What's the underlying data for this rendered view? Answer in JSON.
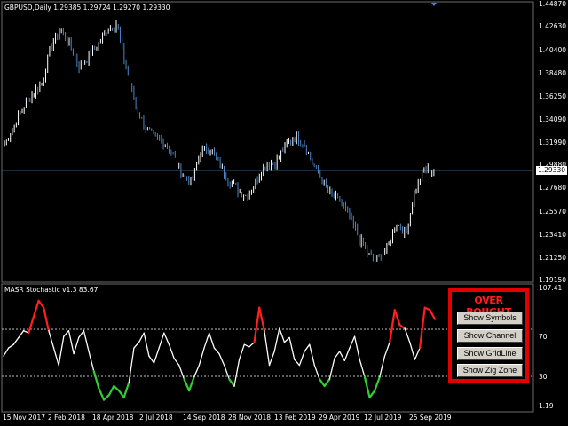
{
  "header": {
    "symbol_info": "GBPUSD,Daily  1.29385 1.29724 1.29270 1.29330",
    "indicator_info": "MASR Stochastic v1.3 83.67"
  },
  "price_axis": {
    "labels": [
      "1.44870",
      "1.42630",
      "1.40400",
      "1.38480",
      "1.36250",
      "1.34090",
      "1.31990",
      "1.29880",
      "1.27680",
      "1.25570",
      "1.23410",
      "1.21250",
      "1.19150"
    ],
    "current": "1.29330"
  },
  "indicator_axis": {
    "labels": [
      "107.41",
      "70",
      "30",
      "1.19"
    ]
  },
  "time_axis": {
    "labels": [
      "15 Nov 2017",
      "2 Feb 2018",
      "18 Apr 2018",
      "2 Jul 2018",
      "14 Sep 2018",
      "28 Nov 2018",
      "13 Feb 2019",
      "29 Apr 2019",
      "12 Jul 2019",
      "25 Sep 2019"
    ]
  },
  "panel": {
    "title": "OVER BOUGHT",
    "buttons": [
      "Show Symbols",
      "Show Channel",
      "Show GridLine",
      "Show Zig Zone"
    ]
  },
  "colors": {
    "background": "#000000",
    "candles_bull": "#ffffff",
    "candles_bear": "#4f86c6",
    "overbought": "#ff2020",
    "oversold": "#30d030",
    "border": "#e00000"
  },
  "chart_data": {
    "type": "line",
    "title": "GBPUSD,Daily",
    "price_series": [
      {
        "t": "15 Nov 2017",
        "v": 1.318
      },
      {
        "t": "",
        "v": 1.335
      },
      {
        "t": "",
        "v": 1.352
      },
      {
        "t": "",
        "v": 1.365
      },
      {
        "t": "",
        "v": 1.375
      },
      {
        "t": "",
        "v": 1.41
      },
      {
        "t": "",
        "v": 1.425
      },
      {
        "t": "2 Feb 2018",
        "v": 1.41
      },
      {
        "t": "",
        "v": 1.39
      },
      {
        "t": "",
        "v": 1.4
      },
      {
        "t": "",
        "v": 1.41
      },
      {
        "t": "",
        "v": 1.425
      },
      {
        "t": "18 Apr 2018",
        "v": 1.43
      },
      {
        "t": "",
        "v": 1.39
      },
      {
        "t": "",
        "v": 1.355
      },
      {
        "t": "",
        "v": 1.335
      },
      {
        "t": "",
        "v": 1.325
      },
      {
        "t": "2 Jul 2018",
        "v": 1.32
      },
      {
        "t": "",
        "v": 1.31
      },
      {
        "t": "",
        "v": 1.29
      },
      {
        "t": "",
        "v": 1.283
      },
      {
        "t": "14 Sep 2018",
        "v": 1.31
      },
      {
        "t": "",
        "v": 1.315
      },
      {
        "t": "",
        "v": 1.3
      },
      {
        "t": "",
        "v": 1.285
      },
      {
        "t": "28 Nov 2018",
        "v": 1.275
      },
      {
        "t": "",
        "v": 1.27
      },
      {
        "t": "",
        "v": 1.285
      },
      {
        "t": "",
        "v": 1.3
      },
      {
        "t": "13 Feb 2019",
        "v": 1.3
      },
      {
        "t": "",
        "v": 1.315
      },
      {
        "t": "",
        "v": 1.325
      },
      {
        "t": "",
        "v": 1.32
      },
      {
        "t": "29 Apr 2019",
        "v": 1.3
      },
      {
        "t": "",
        "v": 1.285
      },
      {
        "t": "",
        "v": 1.27
      },
      {
        "t": "",
        "v": 1.265
      },
      {
        "t": "12 Jul 2019",
        "v": 1.25
      },
      {
        "t": "",
        "v": 1.23
      },
      {
        "t": "",
        "v": 1.215
      },
      {
        "t": "",
        "v": 1.21
      },
      {
        "t": "",
        "v": 1.222
      },
      {
        "t": "",
        "v": 1.245
      },
      {
        "t": "25 Sep 2019",
        "v": 1.235
      },
      {
        "t": "",
        "v": 1.275
      },
      {
        "t": "",
        "v": 1.295
      },
      {
        "t": "",
        "v": 1.2933
      }
    ],
    "stochastic": [
      48,
      55,
      58,
      64,
      70,
      68,
      82,
      96,
      90,
      70,
      55,
      40,
      65,
      70,
      50,
      64,
      70,
      52,
      35,
      20,
      10,
      14,
      22,
      18,
      12,
      25,
      55,
      60,
      68,
      48,
      42,
      55,
      68,
      58,
      46,
      40,
      28,
      18,
      30,
      40,
      55,
      68,
      55,
      50,
      40,
      28,
      22,
      45,
      58,
      56,
      60,
      90,
      70,
      40,
      52,
      72,
      60,
      64,
      45,
      40,
      52,
      58,
      40,
      28,
      22,
      28,
      46,
      52,
      44,
      55,
      65,
      45,
      30,
      12,
      18,
      30,
      48,
      60,
      88,
      75,
      72,
      60,
      45,
      55,
      90,
      88,
      80
    ],
    "levels": {
      "overbought": 70,
      "oversold": 30
    },
    "ylim_price": [
      1.1915,
      1.4487
    ],
    "ylim_ind": [
      1.19,
      107.41
    ]
  }
}
